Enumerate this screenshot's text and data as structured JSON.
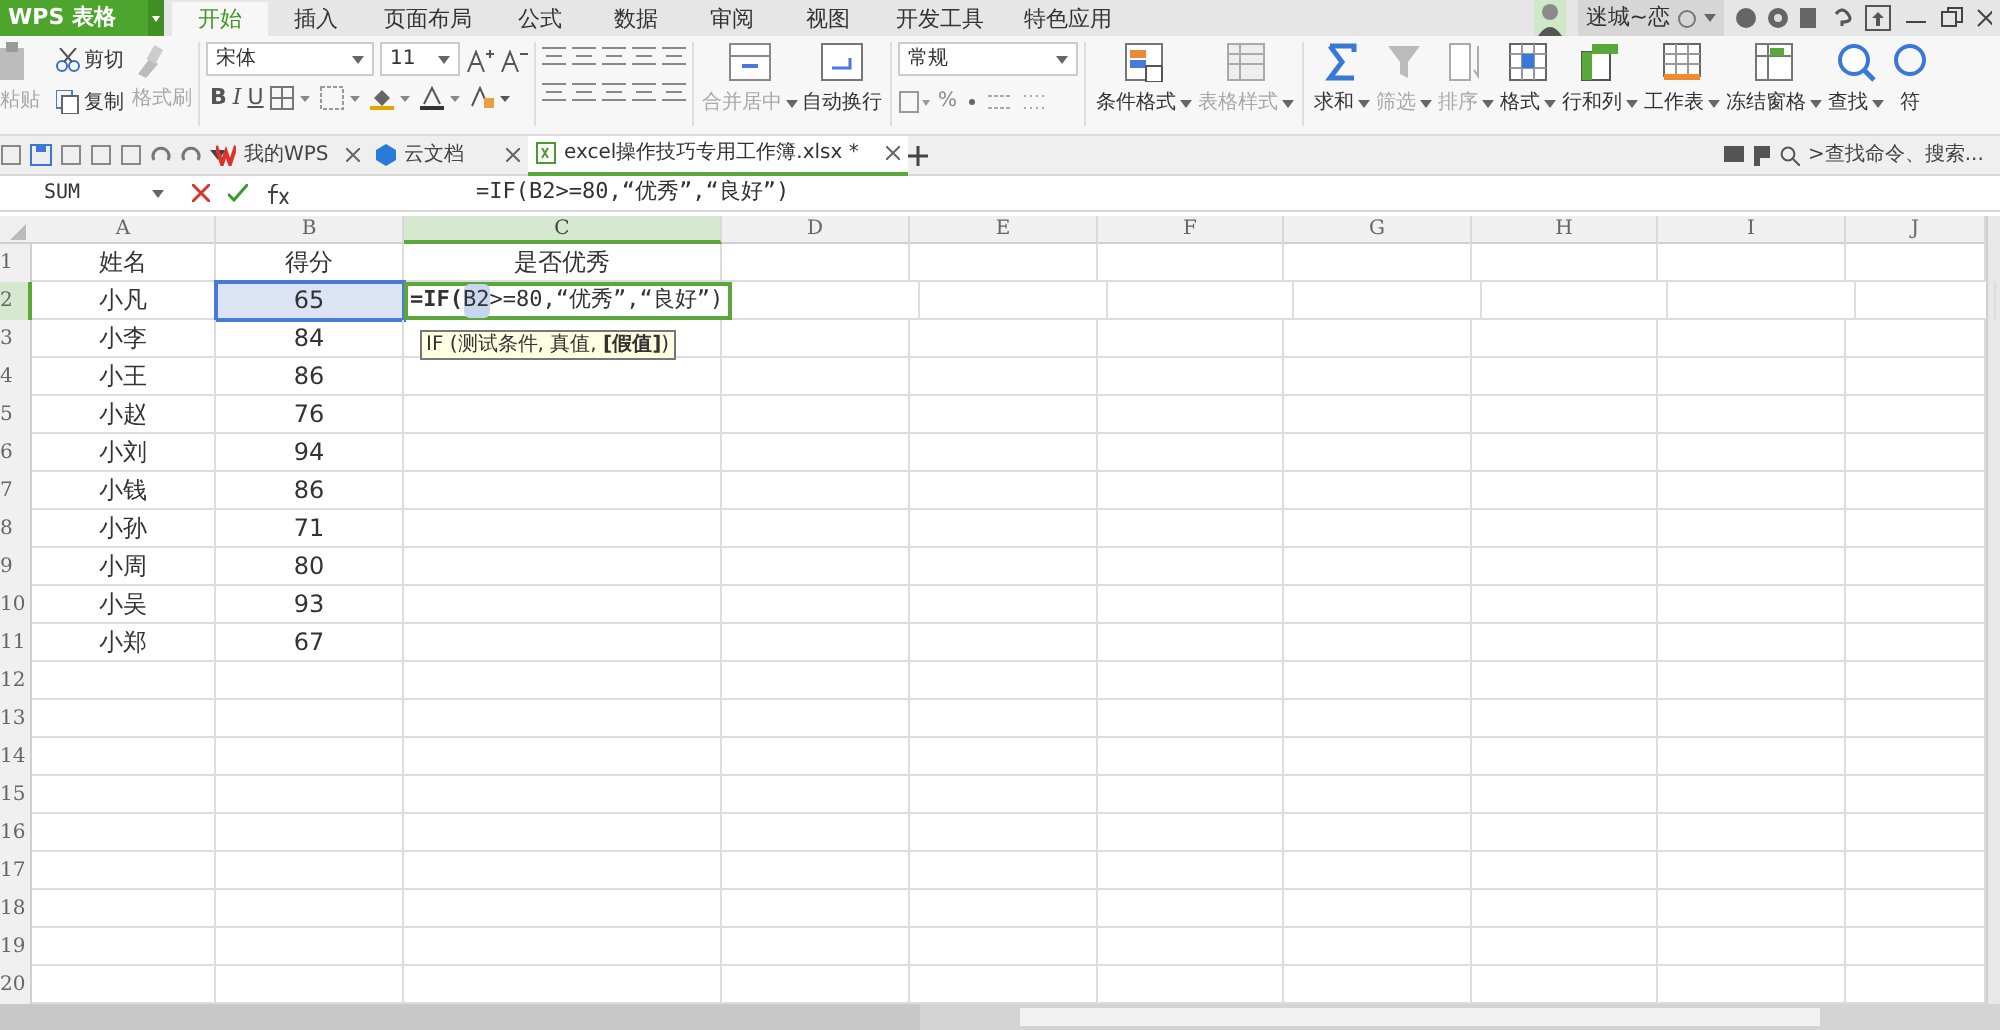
{
  "app": {
    "logo": "WPS 表格"
  },
  "menu_tabs": [
    {
      "label": "开始",
      "selected": true
    },
    {
      "label": "插入",
      "selected": false
    },
    {
      "label": "页面布局",
      "selected": false
    },
    {
      "label": "公式",
      "selected": false
    },
    {
      "label": "数据",
      "selected": false
    },
    {
      "label": "审阅",
      "selected": false
    },
    {
      "label": "视图",
      "selected": false
    },
    {
      "label": "开发工具",
      "selected": false
    },
    {
      "label": "特色应用",
      "selected": false
    }
  ],
  "user": {
    "name": "迷城~恋"
  },
  "ribbon": {
    "clipboard": {
      "paste": {
        "label": "粘贴",
        "disabled": true
      },
      "cut": {
        "label": "剪切",
        "disabled": false
      },
      "copy": {
        "label": "复制",
        "disabled": false
      },
      "painter": {
        "label": "格式刷",
        "disabled": true
      }
    },
    "font": {
      "name": "宋体",
      "size": "11",
      "styles": [
        "B",
        "I",
        "U"
      ]
    },
    "merge": {
      "label": "合并居中",
      "disabled": true
    },
    "wrap": {
      "label": "自动换行",
      "disabled": false
    },
    "number_format": "常规",
    "percent": "%",
    "large_buttons": [
      {
        "label": "条件格式",
        "disabled": false,
        "kind": "conditional"
      },
      {
        "label": "表格样式",
        "disabled": true,
        "kind": "table"
      },
      {
        "label": "求和",
        "disabled": false,
        "kind": "sum"
      },
      {
        "label": "筛选",
        "disabled": true,
        "kind": "filter"
      },
      {
        "label": "排序",
        "disabled": true,
        "kind": "sort"
      },
      {
        "label": "格式",
        "disabled": false,
        "kind": "format"
      },
      {
        "label": "行和列",
        "disabled": false,
        "kind": "rowcol"
      },
      {
        "label": "工作表",
        "disabled": false,
        "kind": "sheet"
      },
      {
        "label": "冻结窗格",
        "disabled": false,
        "kind": "freeze"
      },
      {
        "label": "查找",
        "disabled": false,
        "kind": "find"
      },
      {
        "label": "符",
        "disabled": false,
        "kind": "symbol"
      }
    ]
  },
  "doc_tabs": [
    {
      "label": "我的WPS",
      "selected": false,
      "kind": "wps"
    },
    {
      "label": "云文档",
      "selected": false,
      "kind": "cloud"
    },
    {
      "label": "excel操作技巧专用工作簿.xlsx *",
      "selected": true,
      "kind": "sheet"
    }
  ],
  "command_search": {
    "placeholder": ">查找命令、搜索..."
  },
  "formula_bar": {
    "name_box": "SUM",
    "formula": "=IF(B2>=80,“优秀”,“良好”)"
  },
  "grid": {
    "columns": [
      {
        "label": "A",
        "selected": false
      },
      {
        "label": "B",
        "selected": false
      },
      {
        "label": "C",
        "selected": true
      },
      {
        "label": "D",
        "selected": false
      },
      {
        "label": "E",
        "selected": false
      },
      {
        "label": "F",
        "selected": false
      },
      {
        "label": "G",
        "selected": false
      },
      {
        "label": "H",
        "selected": false
      },
      {
        "label": "I",
        "selected": false
      },
      {
        "label": "J",
        "selected": false
      }
    ],
    "rows": [
      {
        "number": "1",
        "selected": false,
        "cells": [
          {
            "text": "姓名",
            "referenced": false
          },
          {
            "text": "得分",
            "referenced": false
          },
          {
            "text": "是否优秀",
            "referenced": false
          }
        ]
      },
      {
        "number": "2",
        "selected": true,
        "cells": [
          {
            "text": "小凡",
            "referenced": false
          },
          {
            "text": "65",
            "referenced": true
          }
        ]
      },
      {
        "number": "3",
        "selected": false,
        "cells": [
          {
            "text": "小李",
            "referenced": false
          },
          {
            "text": "84",
            "referenced": false
          }
        ]
      },
      {
        "number": "4",
        "selected": false,
        "cells": [
          {
            "text": "小王",
            "referenced": false
          },
          {
            "text": "86",
            "referenced": false
          }
        ]
      },
      {
        "number": "5",
        "selected": false,
        "cells": [
          {
            "text": "小赵",
            "referenced": false
          },
          {
            "text": "76",
            "referenced": false
          }
        ]
      },
      {
        "number": "6",
        "selected": false,
        "cells": [
          {
            "text": "小刘",
            "referenced": false
          },
          {
            "text": "94",
            "referenced": false
          }
        ]
      },
      {
        "number": "7",
        "selected": false,
        "cells": [
          {
            "text": "小钱",
            "referenced": false
          },
          {
            "text": "86",
            "referenced": false
          }
        ]
      },
      {
        "number": "8",
        "selected": false,
        "cells": [
          {
            "text": "小孙",
            "referenced": false
          },
          {
            "text": "71",
            "referenced": false
          }
        ]
      },
      {
        "number": "9",
        "selected": false,
        "cells": [
          {
            "text": "小周",
            "referenced": false
          },
          {
            "text": "80",
            "referenced": false
          }
        ]
      },
      {
        "number": "10",
        "selected": false,
        "cells": [
          {
            "text": "小吴",
            "referenced": false
          },
          {
            "text": "93",
            "referenced": false
          }
        ]
      },
      {
        "number": "11",
        "selected": false,
        "cells": [
          {
            "text": "小郑",
            "referenced": false
          },
          {
            "text": "67",
            "referenced": false
          }
        ]
      },
      {
        "number": "12",
        "selected": false,
        "cells": []
      },
      {
        "number": "13",
        "selected": false,
        "cells": []
      },
      {
        "number": "14",
        "selected": false,
        "cells": []
      },
      {
        "number": "15",
        "selected": false,
        "cells": []
      },
      {
        "number": "16",
        "selected": false,
        "cells": []
      },
      {
        "number": "17",
        "selected": false,
        "cells": []
      },
      {
        "number": "18",
        "selected": false,
        "cells": []
      },
      {
        "number": "19",
        "selected": false,
        "cells": []
      },
      {
        "number": "20",
        "selected": false,
        "cells": []
      }
    ],
    "editor": {
      "before": "=IF(",
      "ref": "B2",
      "after": ">=80,“优秀”,“良好”)"
    },
    "tooltip": "IF (测试条件, 真值, **[假值]**)"
  }
}
